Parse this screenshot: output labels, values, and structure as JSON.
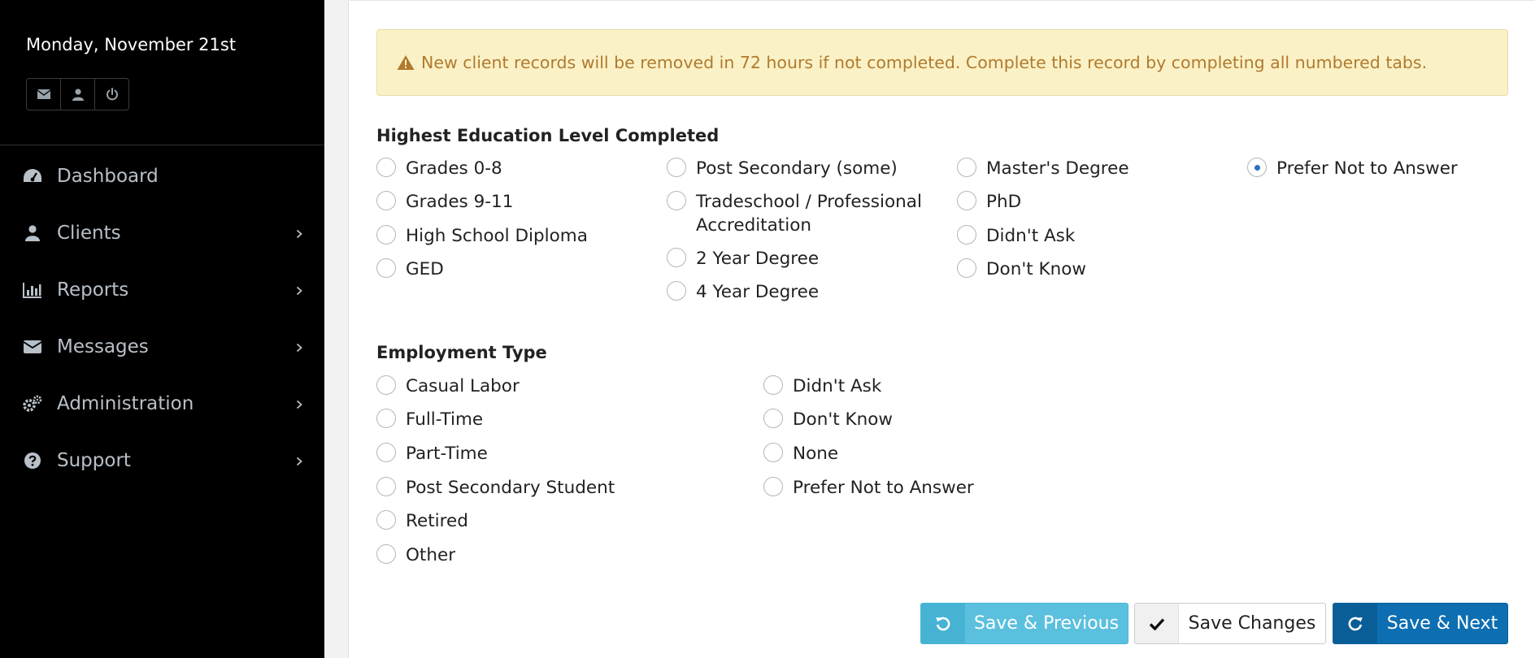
{
  "sidebar": {
    "date": "Monday, November 21st",
    "quick_icons": [
      "envelope-icon",
      "user-icon",
      "power-icon"
    ],
    "items": [
      {
        "label": "Dashboard",
        "icon": "dashboard-icon",
        "has_chevron": false
      },
      {
        "label": "Clients",
        "icon": "user-icon",
        "has_chevron": true
      },
      {
        "label": "Reports",
        "icon": "bar-chart-icon",
        "has_chevron": true
      },
      {
        "label": "Messages",
        "icon": "envelope-icon",
        "has_chevron": true
      },
      {
        "label": "Administration",
        "icon": "gears-icon",
        "has_chevron": true
      },
      {
        "label": "Support",
        "icon": "question-circle-icon",
        "has_chevron": true
      }
    ]
  },
  "alert": {
    "icon": "warning-icon",
    "text": "New client records will be removed in 72 hours if not completed. Complete this record by completing all numbered tabs."
  },
  "education": {
    "title": "Highest Education Level Completed",
    "options": [
      {
        "label": "Grades 0-8",
        "checked": false
      },
      {
        "label": "Grades 9-11",
        "checked": false
      },
      {
        "label": "High School Diploma",
        "checked": false
      },
      {
        "label": "GED",
        "checked": false
      },
      {
        "label": "Post Secondary (some)",
        "checked": false
      },
      {
        "label": "Tradeschool / Professional Accreditation",
        "checked": false
      },
      {
        "label": "2 Year Degree",
        "checked": false
      },
      {
        "label": "4 Year Degree",
        "checked": false
      },
      {
        "label": "Master's Degree",
        "checked": false
      },
      {
        "label": "PhD",
        "checked": false
      },
      {
        "label": "Didn't Ask",
        "checked": false
      },
      {
        "label": "Don't Know",
        "checked": false
      },
      {
        "label": "Prefer Not to Answer",
        "checked": true
      }
    ]
  },
  "employment": {
    "title": "Employment Type",
    "options": [
      {
        "label": "Casual Labor",
        "checked": false
      },
      {
        "label": "Full-Time",
        "checked": false
      },
      {
        "label": "Part-Time",
        "checked": false
      },
      {
        "label": "Post Secondary Student",
        "checked": false
      },
      {
        "label": "Retired",
        "checked": false
      },
      {
        "label": "Other",
        "checked": false
      },
      {
        "label": "Didn't Ask",
        "checked": false
      },
      {
        "label": "Don't Know",
        "checked": false
      },
      {
        "label": "None",
        "checked": false
      },
      {
        "label": "Prefer Not to Answer",
        "checked": false
      }
    ]
  },
  "buttons": {
    "previous": {
      "label": "Save & Previous",
      "icon": "undo-icon"
    },
    "save": {
      "label": "Save Changes",
      "icon": "check-icon"
    },
    "next": {
      "label": "Save & Next",
      "icon": "redo-icon"
    }
  },
  "colors": {
    "sidebar_bg": "#000000",
    "alert_bg": "#fbf1c6",
    "alert_text": "#b07a2e",
    "prev_button": "#5bc0de",
    "next_button": "#0d6eb1"
  }
}
